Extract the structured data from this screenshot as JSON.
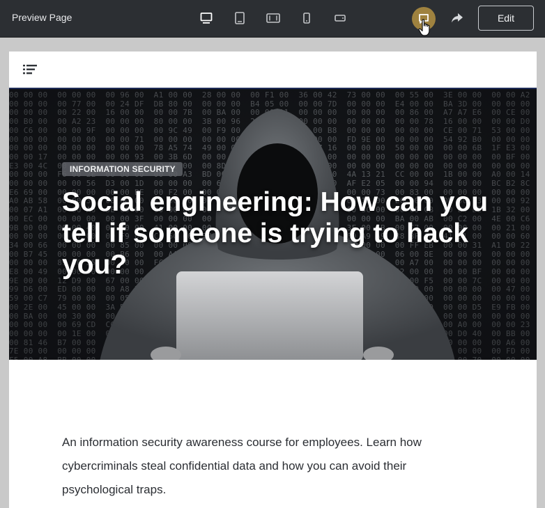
{
  "toolbar": {
    "title": "Preview Page",
    "devices": [
      {
        "name": "desktop",
        "icon": "desktop-icon",
        "active": true
      },
      {
        "name": "tablet-portrait",
        "icon": "tablet-portrait-icon",
        "active": false
      },
      {
        "name": "tablet-landscape",
        "icon": "tablet-landscape-icon",
        "active": false
      },
      {
        "name": "phone-portrait",
        "icon": "phone-portrait-icon",
        "active": false
      },
      {
        "name": "phone-landscape",
        "icon": "phone-landscape-icon",
        "active": false
      }
    ],
    "comment_icon": "comment-icon",
    "share_icon": "share-icon",
    "edit_label": "Edit"
  },
  "page": {
    "menu_icon": "menu-list-icon",
    "hero": {
      "category": "INFORMATION SECURITY",
      "title": "Social engineering: How can you tell if someone is trying to hack you?"
    },
    "description": "An information security awareness course for employees. Learn how cybercriminals steal confidential data and how you can avoid their psychological traps."
  },
  "colors": {
    "toolbar_bg": "#2c2f33",
    "comment_button_bg": "#9f823f",
    "page_bg": "#ffffff",
    "frame_bg": "#c9c9c9",
    "hero_accent_border": "#1d2b57"
  }
}
